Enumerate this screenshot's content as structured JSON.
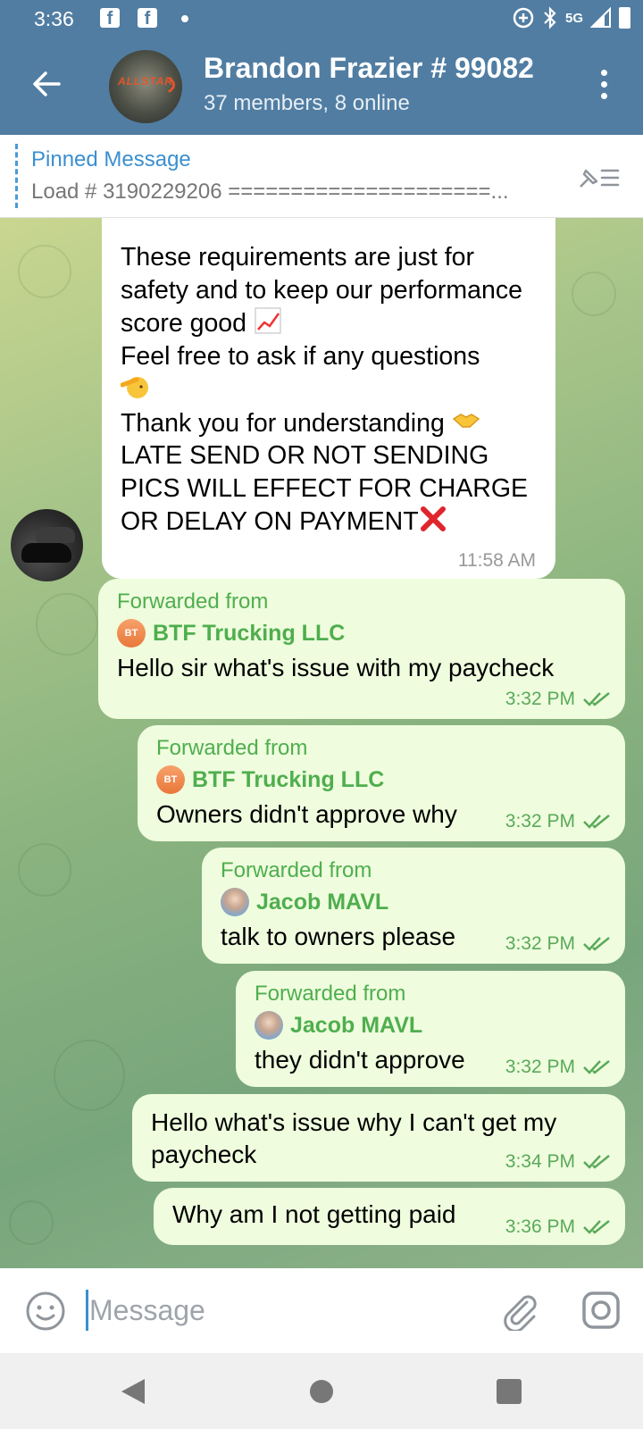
{
  "status_bar": {
    "time": "3:36",
    "network": "5G"
  },
  "header": {
    "title": "Brandon Frazier # 99082",
    "subtitle": "37 members, 8 online",
    "avatar_text": "ALLSTAR"
  },
  "pinned": {
    "label": "Pinned Message",
    "text": "Load # 3190229206  =====================..."
  },
  "messages": {
    "incoming": {
      "line1": "These requirements are just for safety and to keep our performance score good",
      "line2": "Feel free to ask if any questions",
      "line3": "Thank you for understanding",
      "line4": "LATE SEND OR NOT SENDING PICS WILL EFFECT FOR CHARGE OR DELAY ON PAYMENT",
      "time": "11:58 AM"
    },
    "outgoing": [
      {
        "forwarded_label": "Forwarded from",
        "from": "BTF Trucking LLC",
        "from_badge": "BT",
        "text": "Hello sir what's issue with my paycheck",
        "time": "3:32 PM"
      },
      {
        "forwarded_label": "Forwarded from",
        "from": "BTF Trucking LLC",
        "from_badge": "BT",
        "text": "Owners didn't approve why",
        "time": "3:32 PM"
      },
      {
        "forwarded_label": "Forwarded from",
        "from": "Jacob MAVL",
        "text": "talk to owners please",
        "time": "3:32 PM"
      },
      {
        "forwarded_label": "Forwarded from",
        "from": "Jacob MAVL",
        "text": "they didn't approve",
        "time": "3:32 PM"
      },
      {
        "text": "Hello what's issue why I can't get my paycheck",
        "time": "3:34 PM"
      },
      {
        "text": "Why am I not getting paid",
        "time": "3:36 PM"
      }
    ]
  },
  "composer": {
    "placeholder": "Message"
  },
  "colors": {
    "header": "#517da2",
    "accent": "#3a8fd0",
    "outgoing_bubble": "#effdde",
    "forward_green": "#4fae4e"
  }
}
